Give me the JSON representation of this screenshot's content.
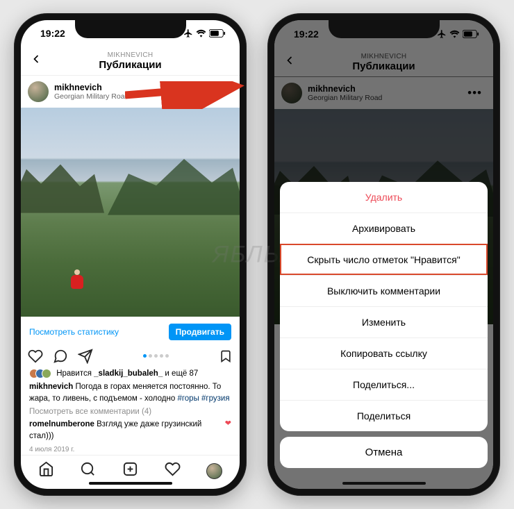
{
  "status": {
    "time": "19:22"
  },
  "nav": {
    "subtitle": "MIKHNEVICH",
    "title": "Публикации"
  },
  "post": {
    "username": "mikhnevich",
    "location": "Georgian Military Road",
    "stats_link": "Посмотреть статистику",
    "promote": "Продвигать",
    "likes_prefix": "Нравится ",
    "likes_user": "_sladkij_bubaleh_",
    "likes_suffix": " и ещё 87",
    "caption_user": "mikhnevich",
    "caption_text": " Погода в горах меняется постоянно. То жара, то ливень, с подъемом - холодно ",
    "caption_hash": "#горы #грузия",
    "view_all": "Посмотреть все комментарии (4)",
    "comment_user": "romelnumberone",
    "comment_text": " Взгляд уже даже грузинский стал)))",
    "date": "4 июля 2019 г."
  },
  "sheet": {
    "items": [
      {
        "label": "Удалить",
        "danger": true
      },
      {
        "label": "Архивировать"
      },
      {
        "label": "Скрыть число отметок \"Нравится\"",
        "highlight": true
      },
      {
        "label": "Выключить комментарии"
      },
      {
        "label": "Изменить"
      },
      {
        "label": "Копировать ссылку"
      },
      {
        "label": "Поделиться..."
      },
      {
        "label": "Поделиться"
      }
    ],
    "cancel": "Отмена"
  },
  "watermark": "ЯБЛЫК"
}
